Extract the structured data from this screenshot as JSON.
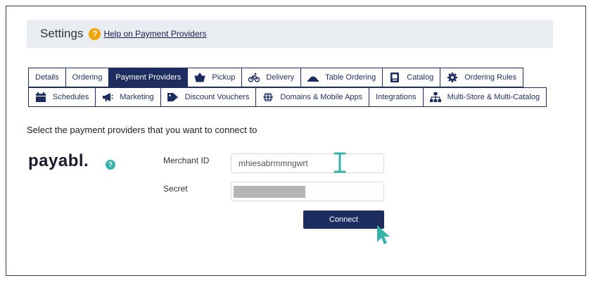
{
  "header": {
    "title": "Settings",
    "help_icon": "help-circle-icon",
    "help_link": "Help on Payment Providers"
  },
  "tabs_row1": [
    {
      "label": "Details",
      "icon": ""
    },
    {
      "label": "Ordering",
      "icon": ""
    },
    {
      "label": "Payment Providers",
      "icon": "",
      "active": true
    },
    {
      "label": "Pickup",
      "icon": "basket-icon"
    },
    {
      "label": "Delivery",
      "icon": "bicycle-icon"
    },
    {
      "label": "Table Ordering",
      "icon": "cloche-icon"
    },
    {
      "label": "Catalog",
      "icon": "catalog-icon"
    },
    {
      "label": "Ordering Rules",
      "icon": "gear-icon"
    }
  ],
  "tabs_row2": [
    {
      "label": "Schedules",
      "icon": "calendar-icon"
    },
    {
      "label": "Marketing",
      "icon": "megaphone-icon"
    },
    {
      "label": "Discount Vouchers",
      "icon": "tag-icon"
    },
    {
      "label": "Domains & Mobile Apps",
      "icon": "globe-icon"
    },
    {
      "label": "Integrations",
      "icon": ""
    },
    {
      "label": "Multi-Store & Multi-Catalog",
      "icon": "sitemap-icon"
    }
  ],
  "section": {
    "label": "Select the payment providers that you want to connect to"
  },
  "provider": {
    "name": "payabl.",
    "help_icon": "help-circle-icon",
    "merchant_id_label": "Merchant ID",
    "merchant_id_value": "mhiesabrmmngwrt",
    "secret_label": "Secret",
    "connect_label": "Connect"
  },
  "colors": {
    "primary": "#1e2d5f",
    "accent": "#39b3a8",
    "help": "#f0a500",
    "header_bg": "#e9edf1"
  }
}
